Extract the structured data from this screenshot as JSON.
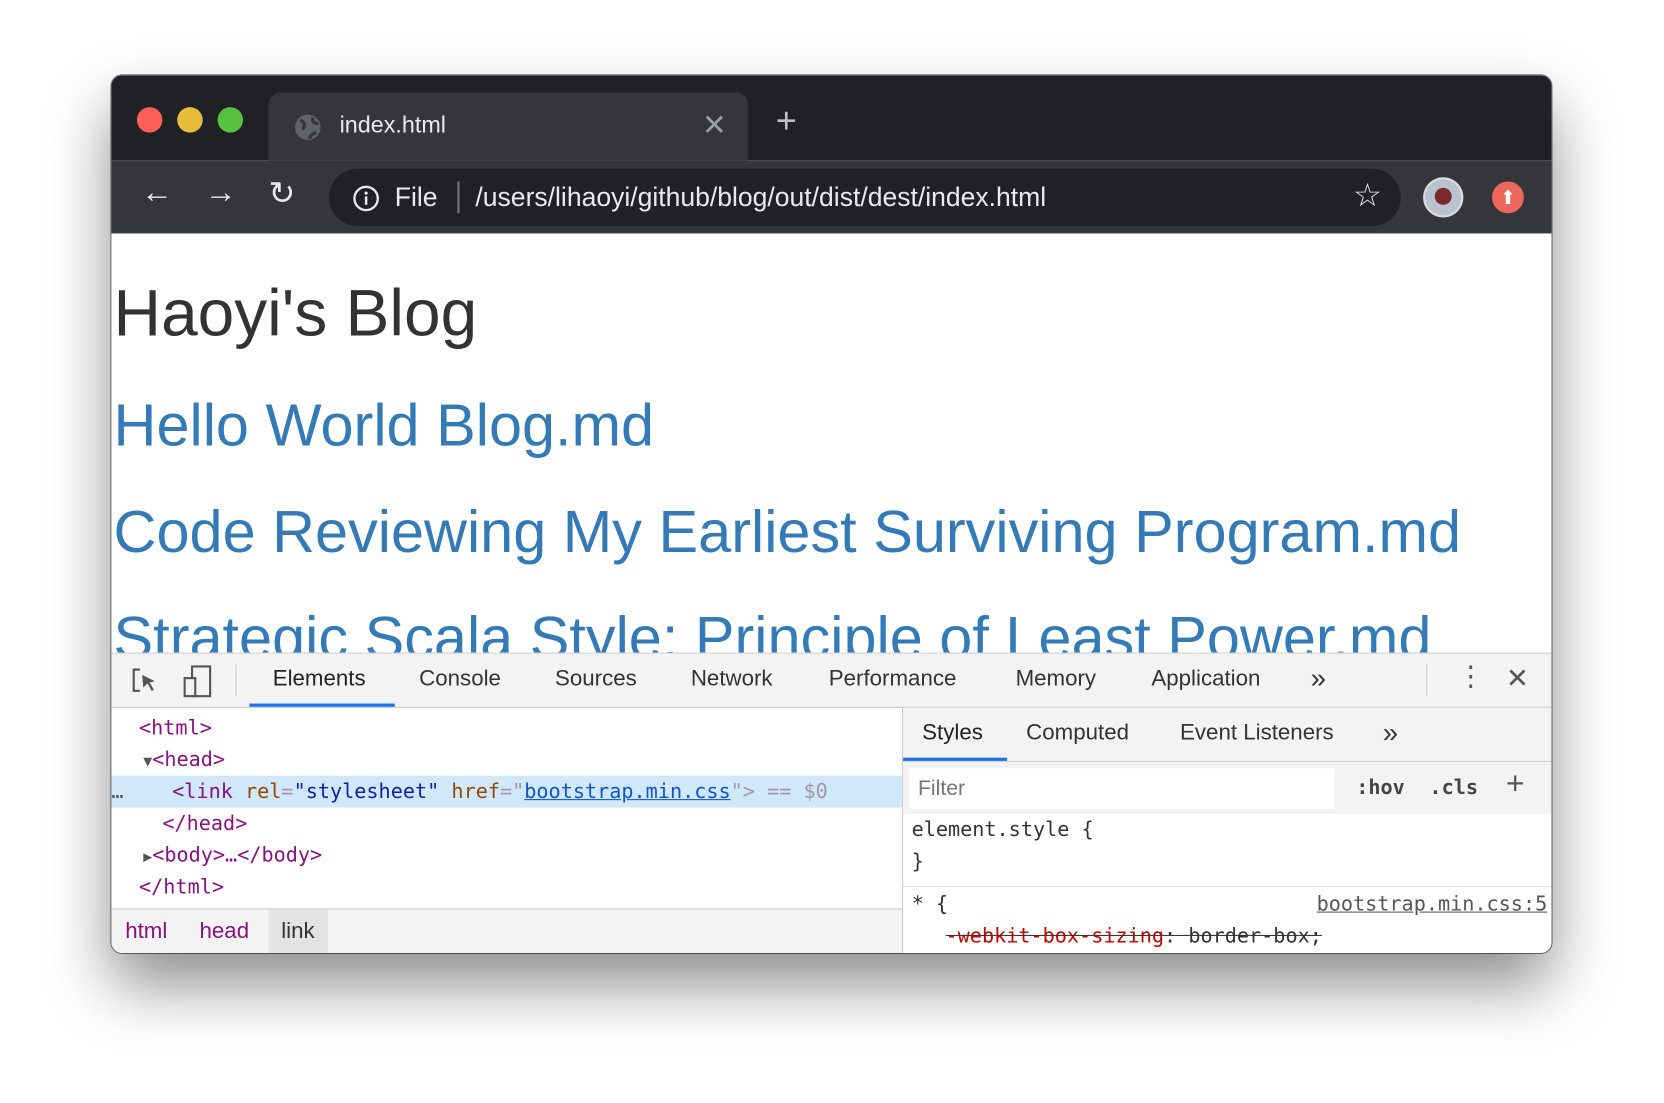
{
  "browser": {
    "tab_title": "index.html",
    "address_scheme": "File",
    "address_url": "/users/lihaoyi/github/blog/out/dist/dest/index.html",
    "traffic_lights": {
      "close": "#fe5f57",
      "minimize": "#e5bd39",
      "maximize": "#5ac03f"
    }
  },
  "page": {
    "title": "Haoyi's Blog",
    "posts": [
      "Hello World Blog.md",
      "Code Reviewing My Earliest Surviving Program.md",
      "Strategic Scala Style: Principle of Least Power.md"
    ],
    "link_color": "#337ab7"
  },
  "devtools": {
    "tabs": [
      "Elements",
      "Console",
      "Sources",
      "Network",
      "Performance",
      "Memory",
      "Application"
    ],
    "active_tab": "Elements",
    "more": "»",
    "tree": {
      "html_open": "<html>",
      "head_open": "<head>",
      "link_tag": "<link",
      "rel_attr": "rel",
      "rel_val": "\"stylesheet\"",
      "href_attr": "href",
      "href_val": "bootstrap.min.css",
      "link_end": "> == $0",
      "head_close": "</head>",
      "body": "<body>…</body>",
      "html_close": "</html>",
      "ellipsis": "…"
    },
    "breadcrumbs": [
      "html",
      "head",
      "link"
    ],
    "styles": {
      "tabs": [
        "Styles",
        "Computed",
        "Event Listeners"
      ],
      "active_tab": "Styles",
      "filter_placeholder": "Filter",
      "hov": ":hov",
      "cls": ".cls",
      "element_style_open": "element.style {",
      "element_style_close": "}",
      "rule_selector": "* {",
      "rule_source": "bootstrap.min.css:5",
      "prop_name": "-webkit-box-sizing",
      "prop_value": "border-box;"
    }
  }
}
